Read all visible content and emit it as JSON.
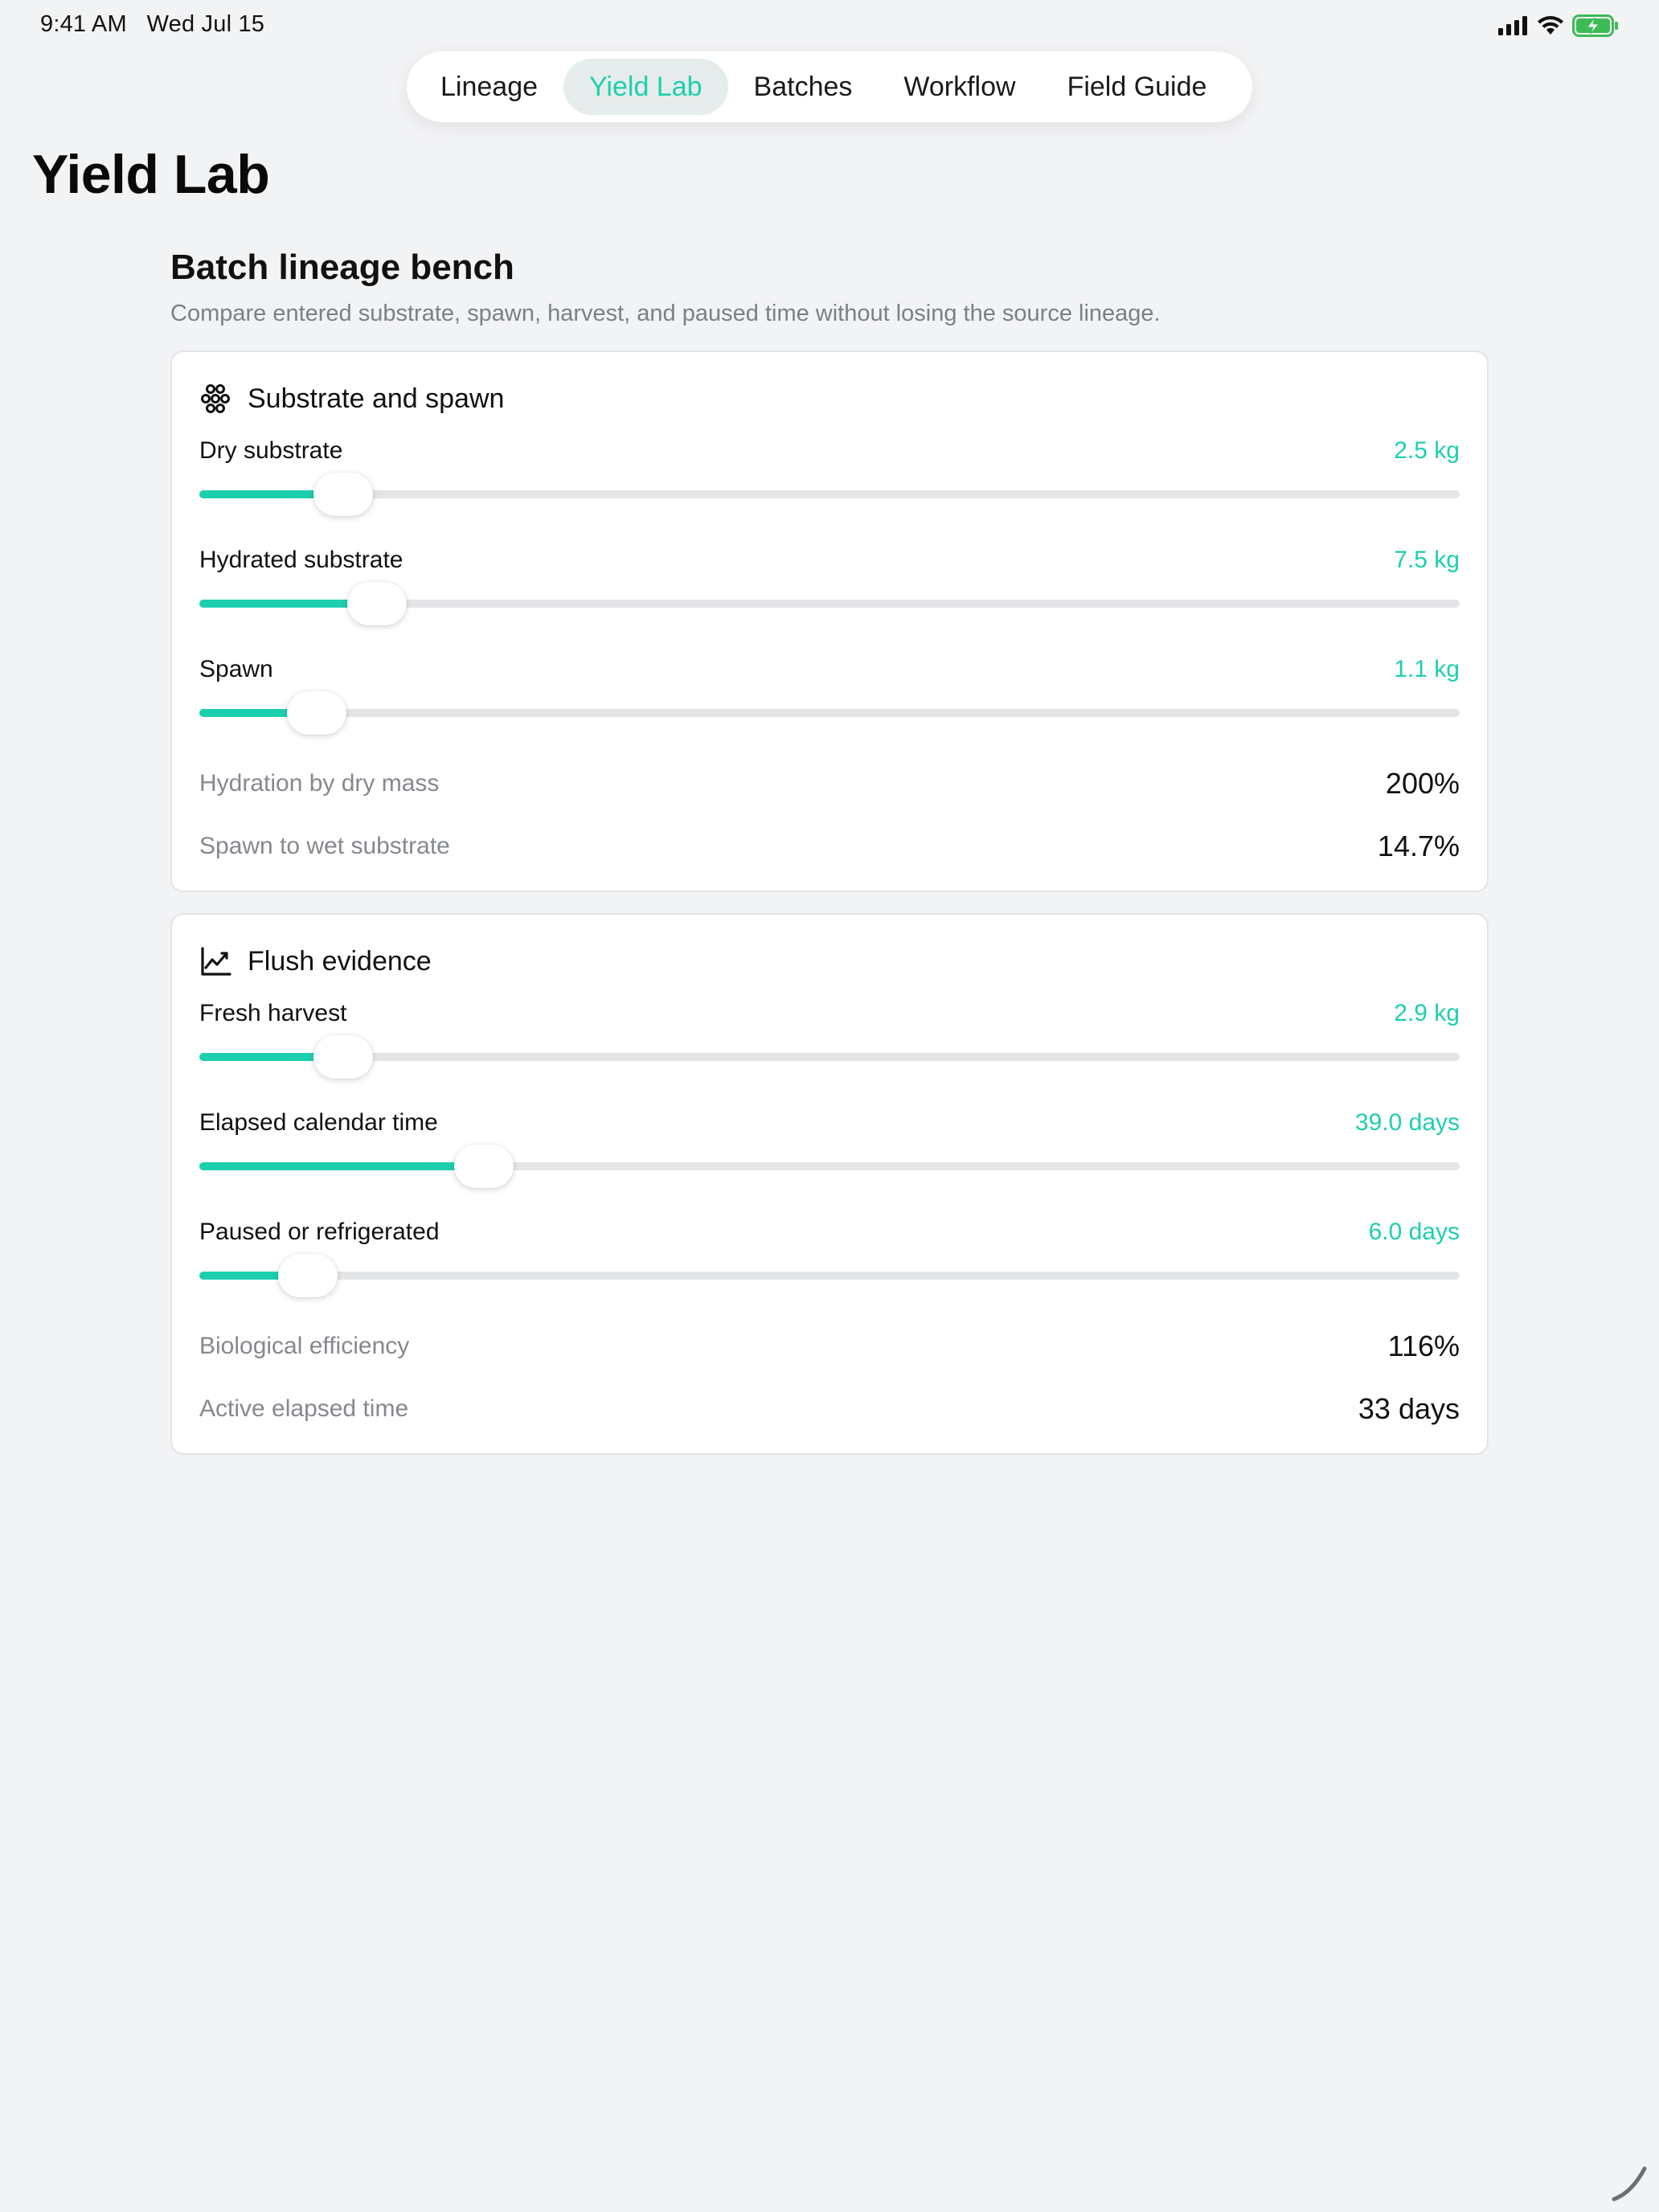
{
  "status": {
    "time": "9:41 AM",
    "date": "Wed Jul 15",
    "icons": [
      "signal-icon",
      "wifi-icon",
      "battery-charging-icon"
    ]
  },
  "tabs": [
    {
      "label": "Lineage",
      "active": false
    },
    {
      "label": "Yield Lab",
      "active": true
    },
    {
      "label": "Batches",
      "active": false
    },
    {
      "label": "Workflow",
      "active": false
    },
    {
      "label": "Field Guide",
      "active": false
    }
  ],
  "page_title": "Yield Lab",
  "section": {
    "title": "Batch lineage bench",
    "subtitle": "Compare entered substrate, spawn, harvest, and paused time without losing the source lineage."
  },
  "cards": {
    "substrate": {
      "title": "Substrate and spawn",
      "icon": "spore-cluster-icon",
      "sliders": [
        {
          "label": "Dry substrate",
          "value": "2.5 kg",
          "fraction": 0.114
        },
        {
          "label": "Hydrated substrate",
          "value": "7.5 kg",
          "fraction": 0.141
        },
        {
          "label": "Spawn",
          "value": "1.1 kg",
          "fraction": 0.093
        }
      ],
      "metrics": [
        {
          "label": "Hydration by dry mass",
          "value": "200%"
        },
        {
          "label": "Spawn to wet substrate",
          "value": "14.7%"
        }
      ]
    },
    "flush": {
      "title": "Flush evidence",
      "icon": "chart-line-icon",
      "sliders": [
        {
          "label": "Fresh harvest",
          "value": "2.9 kg",
          "fraction": 0.114
        },
        {
          "label": "Elapsed calendar time",
          "value": "39.0 days",
          "fraction": 0.226
        },
        {
          "label": "Paused or refrigerated",
          "value": "6.0 days",
          "fraction": 0.086
        }
      ],
      "metrics": [
        {
          "label": "Biological efficiency",
          "value": "116%"
        },
        {
          "label": "Active elapsed time",
          "value": "33 days"
        }
      ]
    }
  },
  "colors": {
    "accent": "#1dcfae",
    "background": "#f2f3f5",
    "track": "#e4e5e7",
    "muted_text": "#85888e"
  }
}
